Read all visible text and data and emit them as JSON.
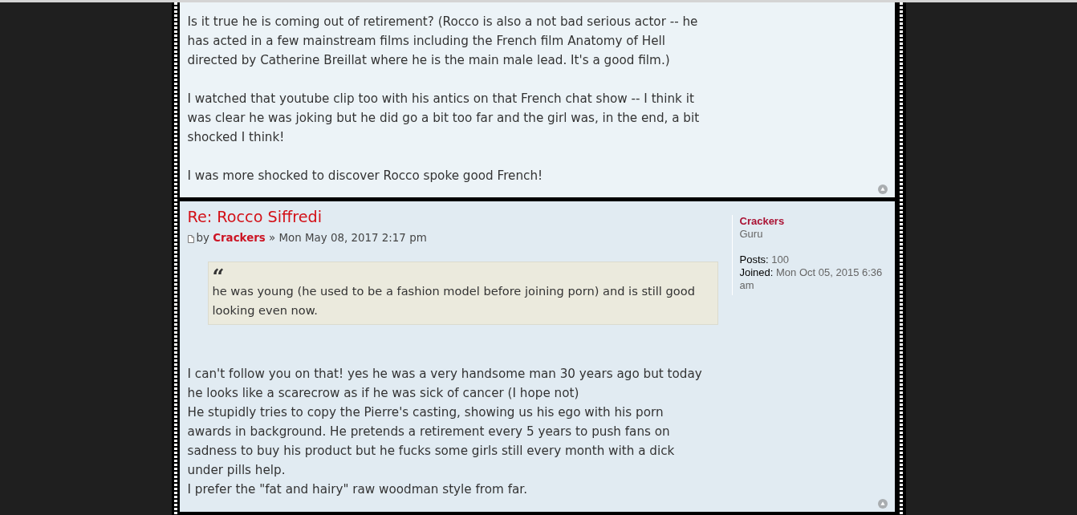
{
  "posts": [
    {
      "kind": "continuation",
      "paragraphs": [
        "Is it true he is coming out of retirement? (Rocco is also a not bad serious actor -- he has acted in a few mainstream films including the French film Anatomy of Hell directed by Catherine Breillat where he is the main male lead. It's a good film.)",
        "I watched that youtube clip too with his antics on that French chat show -- I think it was clear he was joking but he did go a bit too far and the girl was, in the end, a bit shocked I think!",
        "I was more shocked to discover Rocco spoke good French!"
      ]
    },
    {
      "kind": "full",
      "title": "Re: Rocco Siffredi",
      "byline": {
        "prefix": "by",
        "author": "Crackers",
        "suffix": "» Mon May 08, 2017 2:17 pm"
      },
      "quote": {
        "mark": "“",
        "text": "he was young (he used to be a fashion model before joining porn) and is still good looking even now."
      },
      "lines": [
        "I can't follow you on that! yes he was a very handsome man 30 years ago but today he looks like a scarecrow as if he was sick of cancer (I hope not)",
        "He stupidly tries to copy the Pierre's casting, showing us his ego with his porn awards in background. He pretends a retirement every 5 years to push fans on sadness to buy his product but he fucks some girls still every month with a dick under pills help.",
        "I prefer the \"fat and hairy\" raw woodman style from far."
      ],
      "profile": {
        "username": "Crackers",
        "rank": "Guru",
        "fields": [
          {
            "label": "Posts:",
            "value": "100"
          },
          {
            "label": "Joined:",
            "value": "Mon Oct 05, 2015 6:36 am"
          }
        ]
      }
    }
  ]
}
